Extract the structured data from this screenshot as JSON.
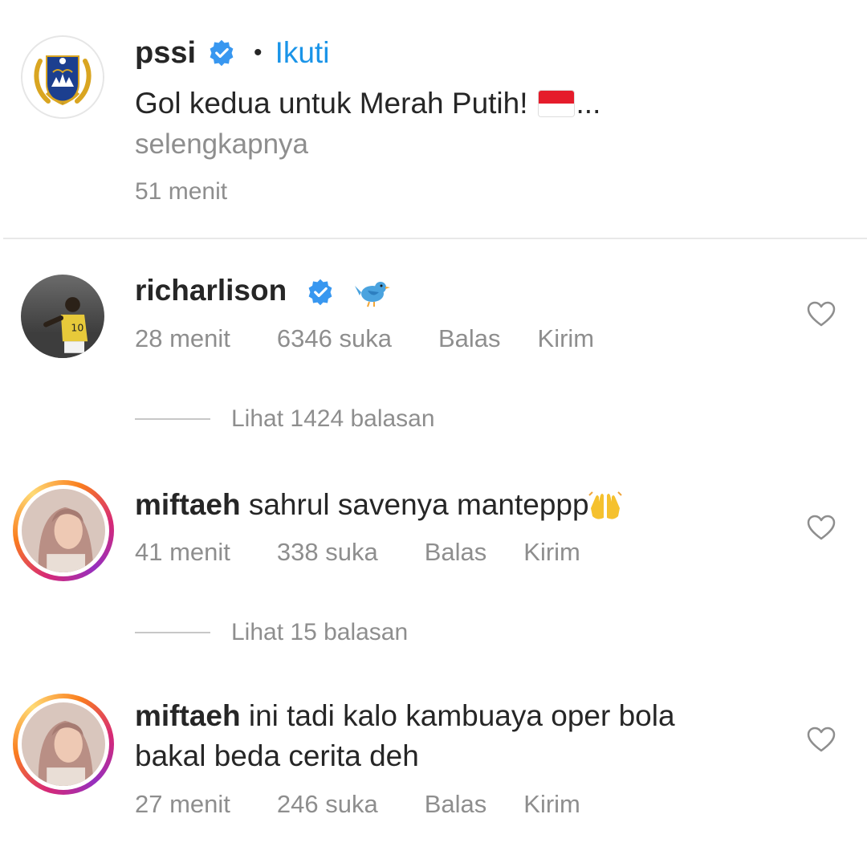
{
  "post": {
    "username": "pssi",
    "follow_label": "Ikuti",
    "separator": "•",
    "caption": "Gol kedua untuk Merah Putih!",
    "caption_ellipsis": "...",
    "more_label": "selengkapnya",
    "time": "51 menit",
    "flag": {
      "top_color": "#e51c2b",
      "bottom_color": "#ffffff"
    }
  },
  "comments": [
    {
      "username": "richarlison",
      "verified": true,
      "text": "",
      "time": "28 menit",
      "likes": "6346 suka",
      "reply_label": "Balas",
      "send_label": "Kirim",
      "view_replies": "Lihat 1424 balasan"
    },
    {
      "username": "miftaeh",
      "text": "sahrul savenya manteppp",
      "time": "41 menit",
      "likes": "338 suka",
      "reply_label": "Balas",
      "send_label": "Kirim",
      "view_replies": "Lihat 15 balasan"
    },
    {
      "username": "miftaeh",
      "text_line1": "ini tadi kalo kambuaya oper bola",
      "text_line2": "bakal beda cerita deh",
      "time": "27 menit",
      "likes": "246 suka",
      "reply_label": "Balas",
      "send_label": "Kirim"
    }
  ],
  "colors": {
    "link_blue": "#1a94e8",
    "secondary_text": "#8e8e8e",
    "primary_text": "#262626",
    "verified_blue": "#3897f0"
  },
  "icons": [
    "verified-badge-icon",
    "heart-icon",
    "bird-emoji-icon",
    "raised-hands-emoji-icon",
    "indonesia-flag-emoji-icon"
  ]
}
